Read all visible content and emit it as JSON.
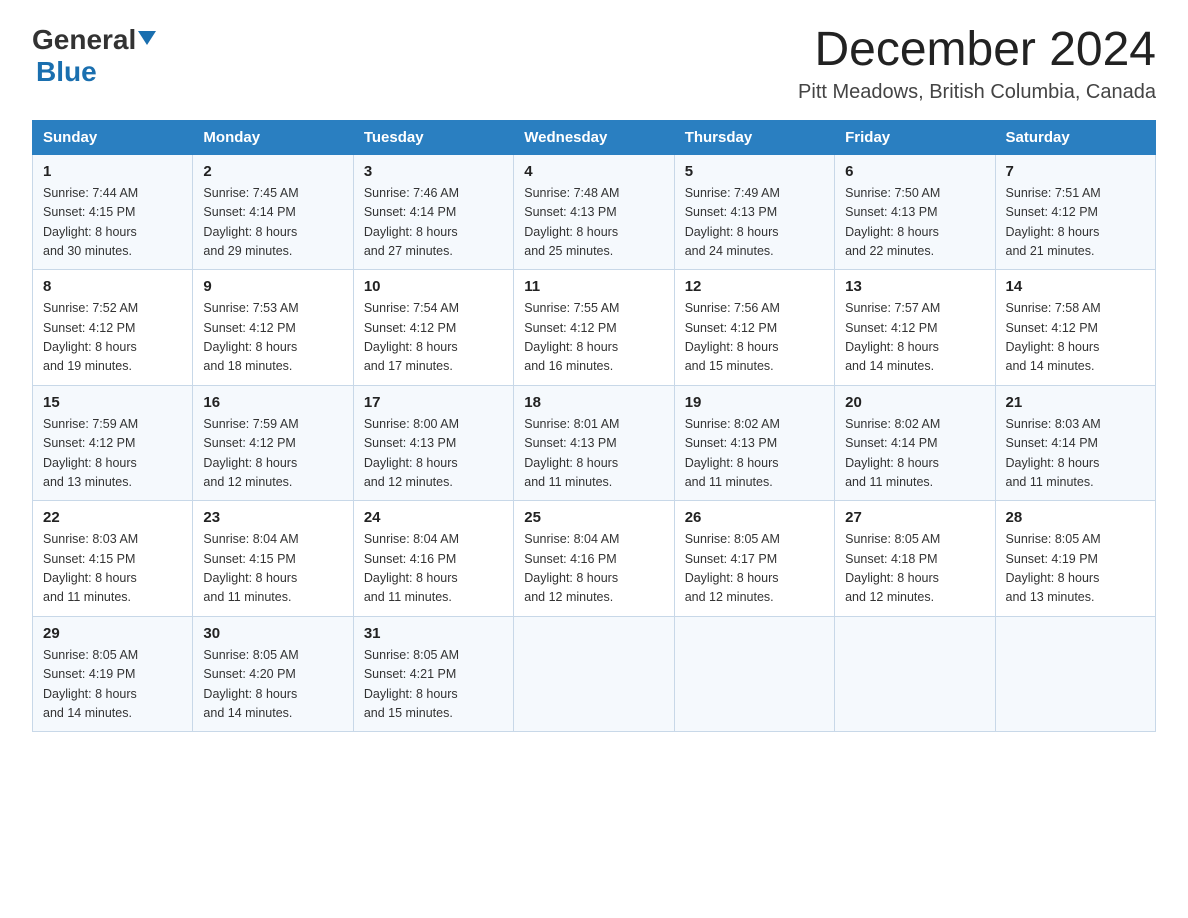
{
  "header": {
    "logo_general": "General",
    "logo_blue": "Blue",
    "month_title": "December 2024",
    "location": "Pitt Meadows, British Columbia, Canada"
  },
  "days_of_week": [
    "Sunday",
    "Monday",
    "Tuesday",
    "Wednesday",
    "Thursday",
    "Friday",
    "Saturday"
  ],
  "weeks": [
    [
      {
        "day": "1",
        "sunrise": "7:44 AM",
        "sunset": "4:15 PM",
        "daylight": "8 hours and 30 minutes."
      },
      {
        "day": "2",
        "sunrise": "7:45 AM",
        "sunset": "4:14 PM",
        "daylight": "8 hours and 29 minutes."
      },
      {
        "day": "3",
        "sunrise": "7:46 AM",
        "sunset": "4:14 PM",
        "daylight": "8 hours and 27 minutes."
      },
      {
        "day": "4",
        "sunrise": "7:48 AM",
        "sunset": "4:13 PM",
        "daylight": "8 hours and 25 minutes."
      },
      {
        "day": "5",
        "sunrise": "7:49 AM",
        "sunset": "4:13 PM",
        "daylight": "8 hours and 24 minutes."
      },
      {
        "day": "6",
        "sunrise": "7:50 AM",
        "sunset": "4:13 PM",
        "daylight": "8 hours and 22 minutes."
      },
      {
        "day": "7",
        "sunrise": "7:51 AM",
        "sunset": "4:12 PM",
        "daylight": "8 hours and 21 minutes."
      }
    ],
    [
      {
        "day": "8",
        "sunrise": "7:52 AM",
        "sunset": "4:12 PM",
        "daylight": "8 hours and 19 minutes."
      },
      {
        "day": "9",
        "sunrise": "7:53 AM",
        "sunset": "4:12 PM",
        "daylight": "8 hours and 18 minutes."
      },
      {
        "day": "10",
        "sunrise": "7:54 AM",
        "sunset": "4:12 PM",
        "daylight": "8 hours and 17 minutes."
      },
      {
        "day": "11",
        "sunrise": "7:55 AM",
        "sunset": "4:12 PM",
        "daylight": "8 hours and 16 minutes."
      },
      {
        "day": "12",
        "sunrise": "7:56 AM",
        "sunset": "4:12 PM",
        "daylight": "8 hours and 15 minutes."
      },
      {
        "day": "13",
        "sunrise": "7:57 AM",
        "sunset": "4:12 PM",
        "daylight": "8 hours and 14 minutes."
      },
      {
        "day": "14",
        "sunrise": "7:58 AM",
        "sunset": "4:12 PM",
        "daylight": "8 hours and 14 minutes."
      }
    ],
    [
      {
        "day": "15",
        "sunrise": "7:59 AM",
        "sunset": "4:12 PM",
        "daylight": "8 hours and 13 minutes."
      },
      {
        "day": "16",
        "sunrise": "7:59 AM",
        "sunset": "4:12 PM",
        "daylight": "8 hours and 12 minutes."
      },
      {
        "day": "17",
        "sunrise": "8:00 AM",
        "sunset": "4:13 PM",
        "daylight": "8 hours and 12 minutes."
      },
      {
        "day": "18",
        "sunrise": "8:01 AM",
        "sunset": "4:13 PM",
        "daylight": "8 hours and 11 minutes."
      },
      {
        "day": "19",
        "sunrise": "8:02 AM",
        "sunset": "4:13 PM",
        "daylight": "8 hours and 11 minutes."
      },
      {
        "day": "20",
        "sunrise": "8:02 AM",
        "sunset": "4:14 PM",
        "daylight": "8 hours and 11 minutes."
      },
      {
        "day": "21",
        "sunrise": "8:03 AM",
        "sunset": "4:14 PM",
        "daylight": "8 hours and 11 minutes."
      }
    ],
    [
      {
        "day": "22",
        "sunrise": "8:03 AM",
        "sunset": "4:15 PM",
        "daylight": "8 hours and 11 minutes."
      },
      {
        "day": "23",
        "sunrise": "8:04 AM",
        "sunset": "4:15 PM",
        "daylight": "8 hours and 11 minutes."
      },
      {
        "day": "24",
        "sunrise": "8:04 AM",
        "sunset": "4:16 PM",
        "daylight": "8 hours and 11 minutes."
      },
      {
        "day": "25",
        "sunrise": "8:04 AM",
        "sunset": "4:16 PM",
        "daylight": "8 hours and 12 minutes."
      },
      {
        "day": "26",
        "sunrise": "8:05 AM",
        "sunset": "4:17 PM",
        "daylight": "8 hours and 12 minutes."
      },
      {
        "day": "27",
        "sunrise": "8:05 AM",
        "sunset": "4:18 PM",
        "daylight": "8 hours and 12 minutes."
      },
      {
        "day": "28",
        "sunrise": "8:05 AM",
        "sunset": "4:19 PM",
        "daylight": "8 hours and 13 minutes."
      }
    ],
    [
      {
        "day": "29",
        "sunrise": "8:05 AM",
        "sunset": "4:19 PM",
        "daylight": "8 hours and 14 minutes."
      },
      {
        "day": "30",
        "sunrise": "8:05 AM",
        "sunset": "4:20 PM",
        "daylight": "8 hours and 14 minutes."
      },
      {
        "day": "31",
        "sunrise": "8:05 AM",
        "sunset": "4:21 PM",
        "daylight": "8 hours and 15 minutes."
      },
      null,
      null,
      null,
      null
    ]
  ],
  "labels": {
    "sunrise": "Sunrise:",
    "sunset": "Sunset:",
    "daylight": "Daylight:"
  }
}
